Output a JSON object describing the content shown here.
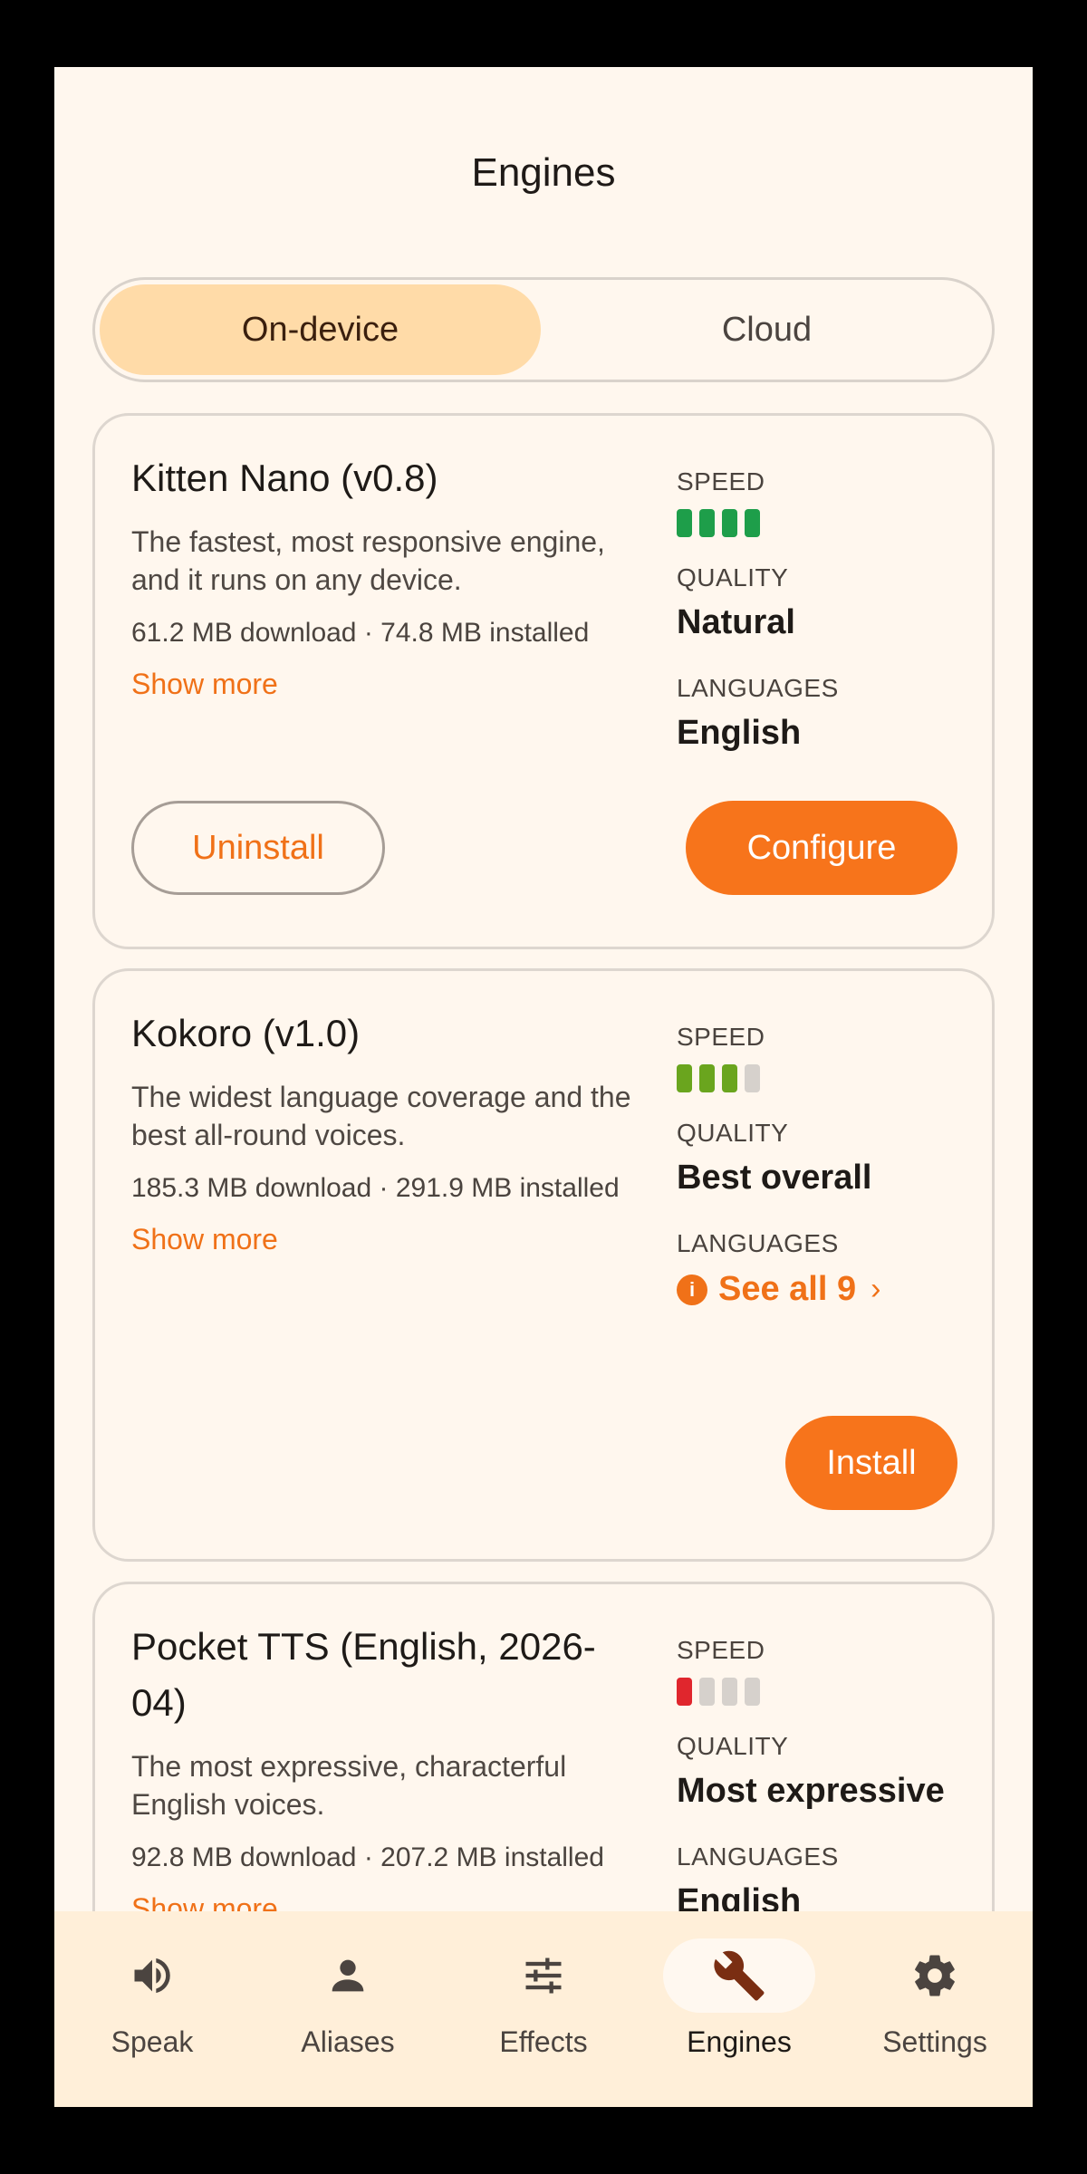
{
  "header": {
    "title": "Engines"
  },
  "tabs": {
    "on_device": "On-device",
    "cloud": "Cloud"
  },
  "engines": [
    {
      "title": "Kitten Nano (v0.8)",
      "description": "The fastest, most responsive engine, and it runs on any device.",
      "sizes": "61.2 MB download · 74.8 MB installed",
      "show_more": "Show more",
      "speed_label": "SPEED",
      "speed_level": 4,
      "speed_color": "#1e9e4a",
      "quality_label": "QUALITY",
      "quality": "Natural",
      "languages_label": "LANGUAGES",
      "languages": "English",
      "secondary_button": "Uninstall",
      "primary_button": "Configure"
    },
    {
      "title": "Kokoro (v1.0)",
      "description": "The widest language coverage and the best all-round voices.",
      "sizes": "185.3 MB download · 291.9 MB installed",
      "show_more": "Show more",
      "speed_label": "SPEED",
      "speed_level": 3,
      "speed_color": "#6aa51e",
      "quality_label": "QUALITY",
      "quality": "Best overall",
      "languages_label": "LANGUAGES",
      "languages_link": "See all 9",
      "primary_button": "Install"
    },
    {
      "title": "Pocket TTS (English, 2026-04)",
      "description": "The most expressive, characterful English voices.",
      "sizes": "92.8 MB download · 207.2 MB installed",
      "show_more": "Show more",
      "speed_label": "SPEED",
      "speed_level": 1,
      "speed_color": "#e0262d",
      "quality_label": "QUALITY",
      "quality": "Most expressive",
      "languages_label": "LANGUAGES",
      "languages": "English"
    }
  ],
  "speed_max": 4,
  "empty_bar_color": "#d6d1cc",
  "accent_color": "#f7741b",
  "nav": [
    {
      "label": "Speak",
      "icon": "speaker-icon"
    },
    {
      "label": "Aliases",
      "icon": "person-icon"
    },
    {
      "label": "Effects",
      "icon": "sliders-icon"
    },
    {
      "label": "Engines",
      "icon": "wrench-icon",
      "active": true
    },
    {
      "label": "Settings",
      "icon": "gear-icon"
    }
  ]
}
